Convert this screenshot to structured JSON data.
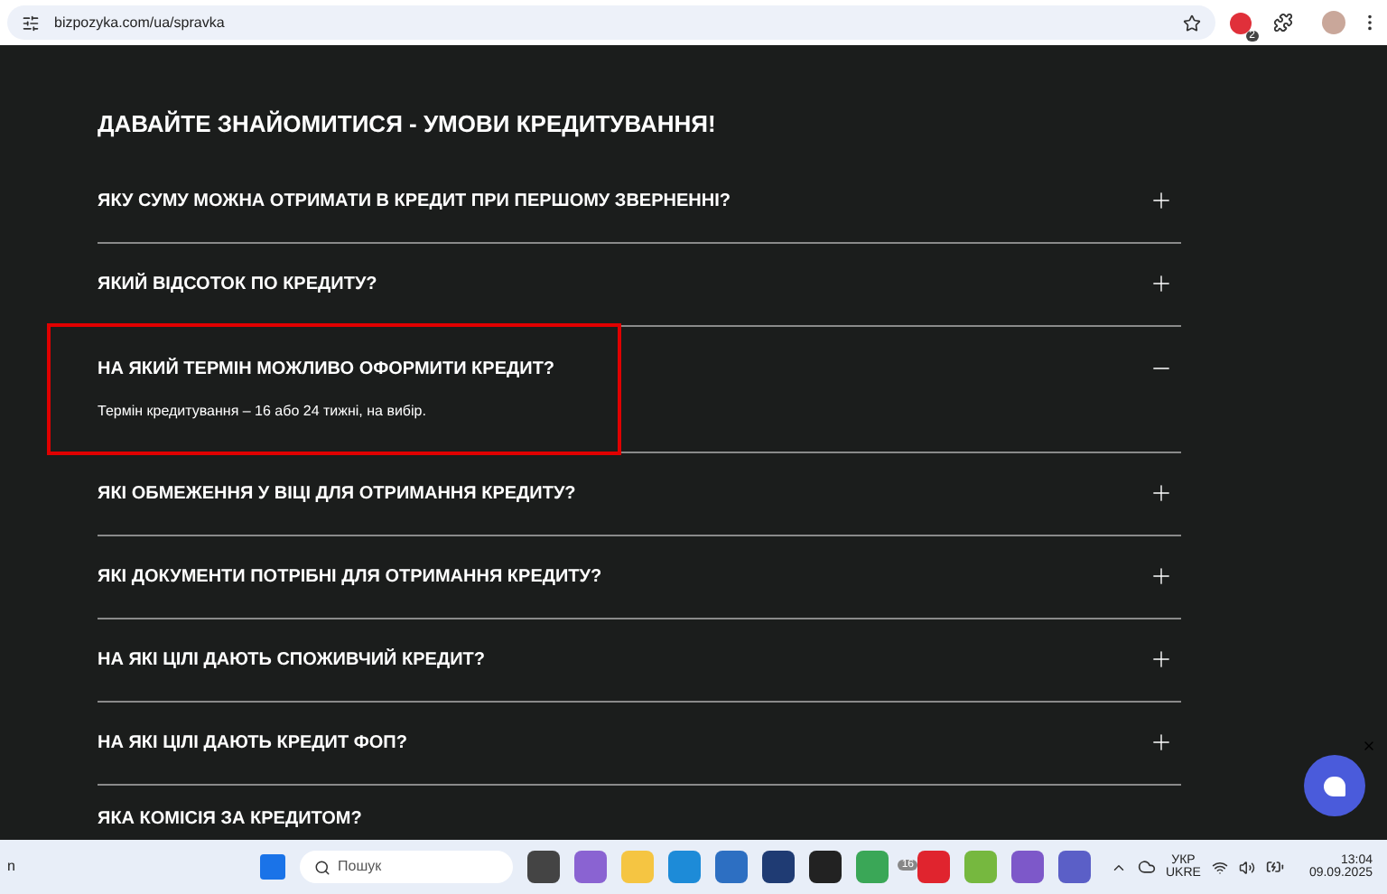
{
  "browser": {
    "url": "bizpozyka.com/ua/spravka",
    "extension_badge": "2"
  },
  "faq": {
    "title": "ДАВАЙТЕ ЗНАЙОМИТИСЯ - УМОВИ КРЕДИТУВАННЯ!",
    "items": [
      {
        "question": "ЯКУ СУМУ МОЖНА ОТРИМАТИ В КРЕДИТ ПРИ ПЕРШОМУ ЗВЕРНЕННІ?",
        "expanded": false,
        "highlighted": false
      },
      {
        "question": "ЯКИЙ ВІДСОТОК ПО КРЕДИТУ?",
        "expanded": false,
        "highlighted": false
      },
      {
        "question": "НА ЯКИЙ ТЕРМІН МОЖЛИВО ОФОРМИТИ КРЕДИТ?",
        "expanded": true,
        "highlighted": true,
        "answer": "Термін кредитування – 16 або 24 тижні, на вибір."
      },
      {
        "question": "ЯКІ ОБМЕЖЕННЯ У ВІЦІ ДЛЯ ОТРИМАННЯ КРЕДИТУ?",
        "expanded": false,
        "highlighted": false
      },
      {
        "question": "ЯКІ ДОКУМЕНТИ ПОТРІБНІ ДЛЯ ОТРИМАННЯ КРЕДИТУ?",
        "expanded": false,
        "highlighted": false
      },
      {
        "question": "НА ЯКІ ЦІЛІ ДАЮТЬ СПОЖИВЧИЙ КРЕДИТ?",
        "expanded": false,
        "highlighted": false
      },
      {
        "question": "НА ЯКІ ЦІЛІ ДАЮТЬ КРЕДИТ ФОП?",
        "expanded": false,
        "highlighted": false
      },
      {
        "question": "ЯКА КОМІСІЯ ЗА КРЕДИТОМ?",
        "expanded": false,
        "highlighted": false
      }
    ]
  },
  "taskbar": {
    "left_text": "n",
    "search_placeholder": "Пошук",
    "telegram_badge": "16",
    "language": "УКР",
    "layout": "UKRE",
    "time": "13:04",
    "date": "09.09.2025"
  }
}
